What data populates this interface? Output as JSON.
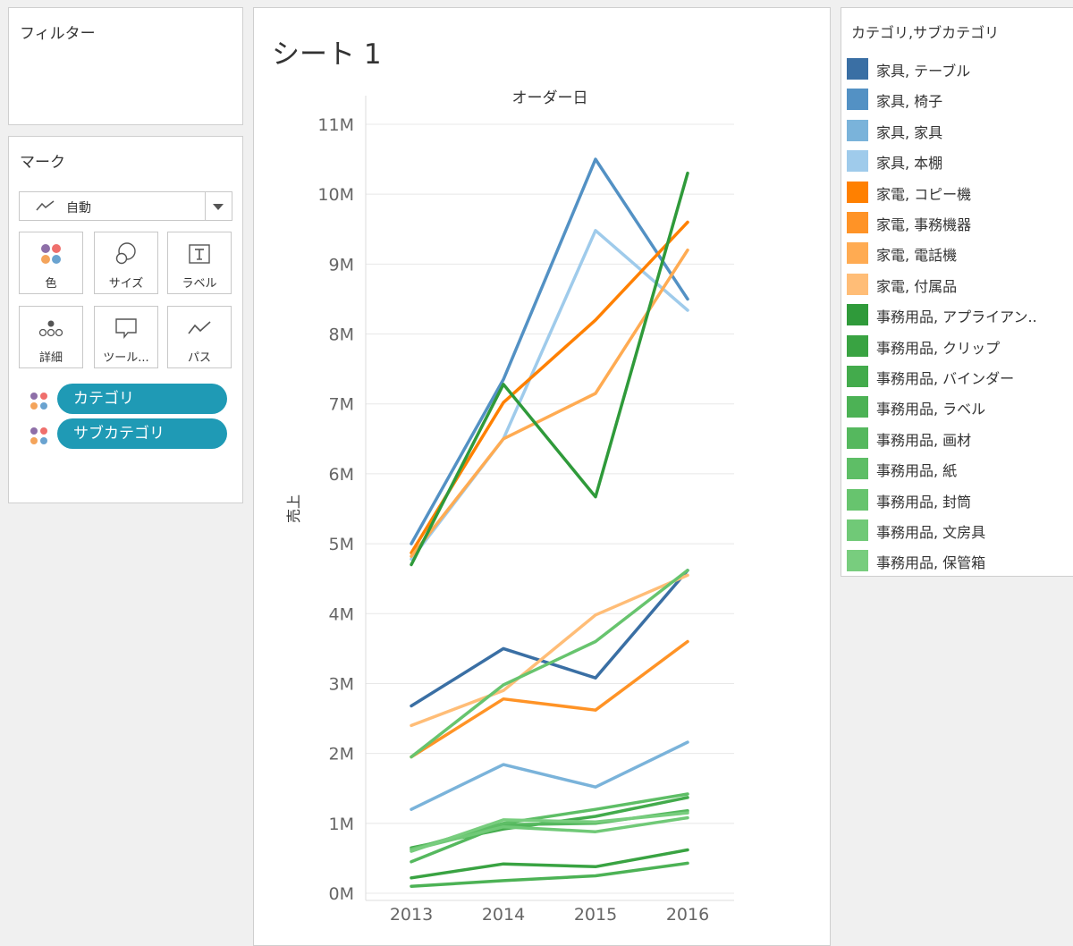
{
  "filters": {
    "title": "フィルター"
  },
  "marks": {
    "title": "マーク",
    "mark_type": "自動",
    "buttons": [
      {
        "label": "色",
        "icon": "color-icon"
      },
      {
        "label": "サイズ",
        "icon": "size-icon"
      },
      {
        "label": "ラベル",
        "icon": "label-icon"
      },
      {
        "label": "詳細",
        "icon": "detail-icon"
      },
      {
        "label": "ツール...",
        "icon": "tooltip-icon"
      },
      {
        "label": "パス",
        "icon": "path-icon"
      }
    ],
    "pills": [
      {
        "label": "カテゴリ",
        "icon": "color-icon"
      },
      {
        "label": "サブカテゴリ",
        "icon": "color-icon"
      }
    ]
  },
  "sheet": {
    "title": "シート 1"
  },
  "legend": {
    "title": "カテゴリ,サブカテゴリ",
    "items": [
      {
        "label": "家具, テーブル",
        "color": "#3a6fa4"
      },
      {
        "label": "家具, 椅子",
        "color": "#5391c4"
      },
      {
        "label": "家具, 家具",
        "color": "#7ab3da"
      },
      {
        "label": "家具, 本棚",
        "color": "#9fcbeb"
      },
      {
        "label": "家電, コピー機",
        "color": "#ff8000"
      },
      {
        "label": "家電, 事務機器",
        "color": "#ff9326"
      },
      {
        "label": "家電, 電話機",
        "color": "#ffab52"
      },
      {
        "label": "家電, 付属品",
        "color": "#ffbd77"
      },
      {
        "label": "事務用品, アプライアン..",
        "color": "#2f9a3a"
      },
      {
        "label": "事務用品, クリップ",
        "color": "#39a342"
      },
      {
        "label": "事務用品, バインダー",
        "color": "#43ab4c"
      },
      {
        "label": "事務用品, ラベル",
        "color": "#4cb255"
      },
      {
        "label": "事務用品, 画材",
        "color": "#55b85e"
      },
      {
        "label": "事務用品, 紙",
        "color": "#5ebe66"
      },
      {
        "label": "事務用品, 封筒",
        "color": "#67c46e"
      },
      {
        "label": "事務用品, 文房具",
        "color": "#70c977"
      },
      {
        "label": "事務用品, 保管箱",
        "color": "#78cd7e"
      }
    ]
  },
  "chart_data": {
    "type": "line",
    "title": "オーダー日",
    "xlabel": "",
    "ylabel": "売上",
    "x": [
      "2013",
      "2014",
      "2015",
      "2016"
    ],
    "ylim": [
      0,
      11000000
    ],
    "yticks": [
      "0M",
      "1M",
      "2M",
      "3M",
      "4M",
      "5M",
      "6M",
      "7M",
      "8M",
      "9M",
      "10M",
      "11M"
    ],
    "series": [
      {
        "name": "家具, テーブル",
        "color": "#3a6fa4",
        "values": [
          2680000,
          3500000,
          3080000,
          4620000
        ]
      },
      {
        "name": "家具, 椅子",
        "color": "#5391c4",
        "values": [
          5000000,
          7350000,
          10500000,
          8500000
        ]
      },
      {
        "name": "家具, 家具",
        "color": "#7ab3da",
        "values": [
          1200000,
          1840000,
          1520000,
          2160000
        ]
      },
      {
        "name": "家具, 本棚",
        "color": "#9fcbeb",
        "values": [
          4780000,
          6500000,
          9480000,
          8340000
        ]
      },
      {
        "name": "家電, コピー機",
        "color": "#ff8000",
        "values": [
          4870000,
          7020000,
          8200000,
          9600000
        ]
      },
      {
        "name": "家電, 事務機器",
        "color": "#ff9326",
        "values": [
          1950000,
          2780000,
          2620000,
          3600000
        ]
      },
      {
        "name": "家電, 電話機",
        "color": "#ffab52",
        "values": [
          4820000,
          6500000,
          7150000,
          9200000
        ]
      },
      {
        "name": "家電, 付属品",
        "color": "#ffbd77",
        "values": [
          2400000,
          2900000,
          3980000,
          4550000
        ]
      },
      {
        "name": "事務用品, アプライアン..",
        "color": "#2f9a3a",
        "values": [
          4700000,
          7280000,
          5670000,
          10300000
        ]
      },
      {
        "name": "事務用品, クリップ",
        "color": "#39a342",
        "values": [
          220000,
          420000,
          380000,
          620000
        ]
      },
      {
        "name": "事務用品, バインダー",
        "color": "#43ab4c",
        "values": [
          650000,
          920000,
          1100000,
          1370000
        ]
      },
      {
        "name": "事務用品, ラベル",
        "color": "#4cb255",
        "values": [
          100000,
          180000,
          250000,
          430000
        ]
      },
      {
        "name": "事務用品, 画材",
        "color": "#55b85e",
        "values": [
          450000,
          980000,
          1000000,
          1180000
        ]
      },
      {
        "name": "事務用品, 紙",
        "color": "#5ebe66",
        "values": [
          630000,
          1000000,
          1200000,
          1420000
        ]
      },
      {
        "name": "事務用品, 封筒",
        "color": "#67c46e",
        "values": [
          1950000,
          2980000,
          3600000,
          4620000
        ]
      },
      {
        "name": "事務用品, 文房具",
        "color": "#70c977",
        "values": [
          620000,
          950000,
          880000,
          1080000
        ]
      },
      {
        "name": "事務用品, 保管箱",
        "color": "#78cd7e",
        "values": [
          600000,
          1050000,
          1020000,
          1150000
        ]
      }
    ]
  }
}
